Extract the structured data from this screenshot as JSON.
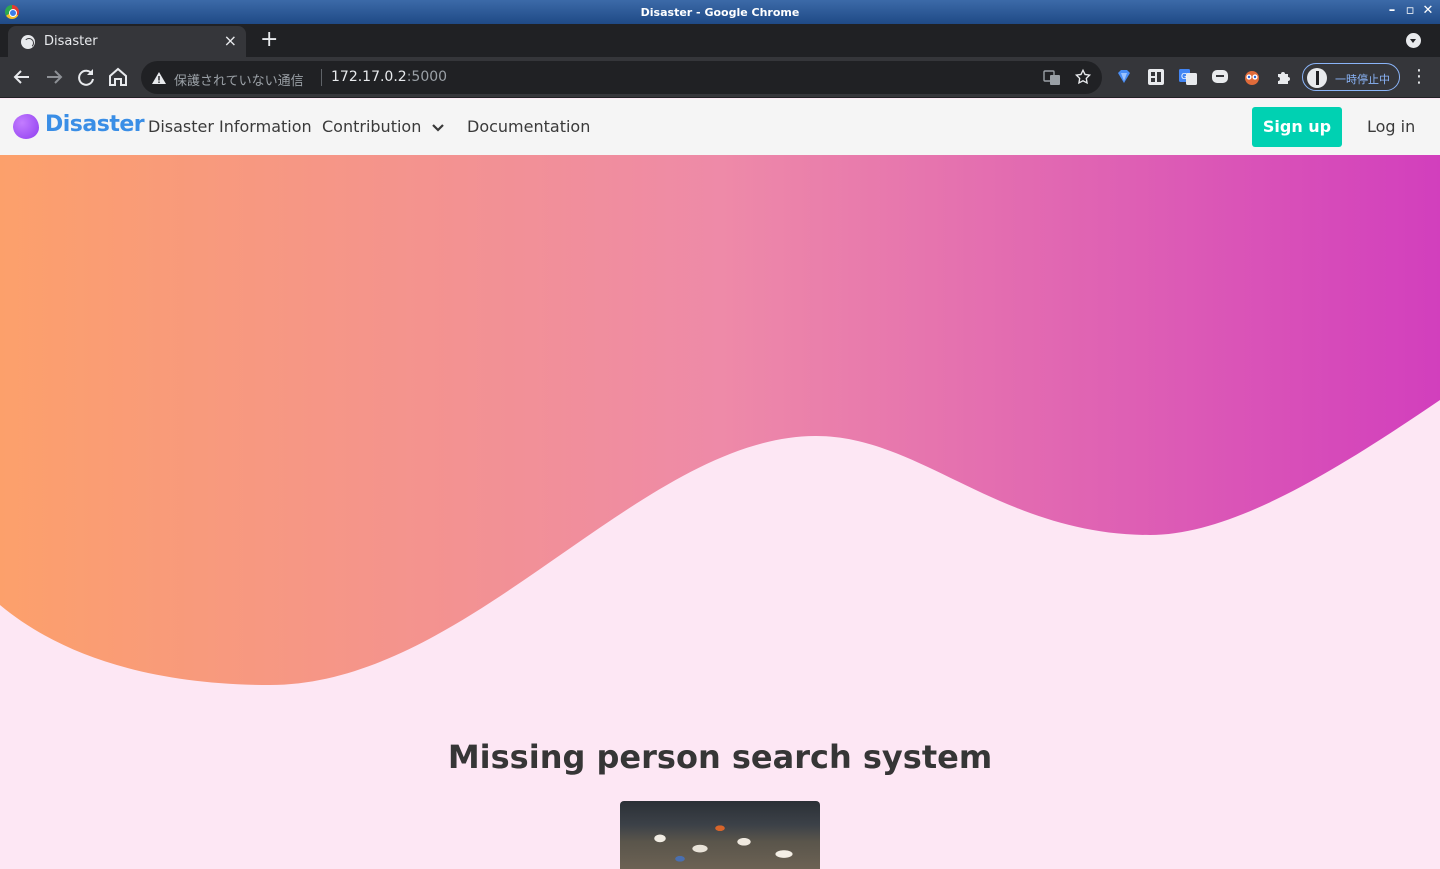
{
  "window": {
    "title": "Disaster - Google Chrome"
  },
  "browser": {
    "tab": {
      "title": "Disaster",
      "close_label": "×"
    },
    "new_tab_label": "+",
    "omnibox": {
      "security_text": "保護されていない通信",
      "url_host": "172.17.0.2",
      "url_port": ":5000"
    },
    "profile_status": "一時停止中",
    "menu_label": "⋮"
  },
  "site": {
    "brand": "Disaster",
    "nav": {
      "disaster_info": "Disaster Information",
      "contribution": "Contribution",
      "documentation": "Documentation"
    },
    "signup_label": "Sign up",
    "login_label": "Log in"
  },
  "hero": {
    "title": "Missing person search system",
    "gradient_start": "#fca06b",
    "gradient_mid": "#ee8aa8",
    "gradient_end": "#d23fbd",
    "background": "#fde7f4"
  },
  "colors": {
    "brand": "#3a8ee6",
    "signup": "#00d1b2",
    "browser_frame": "#202124",
    "browser_toolbar": "#35363a"
  }
}
